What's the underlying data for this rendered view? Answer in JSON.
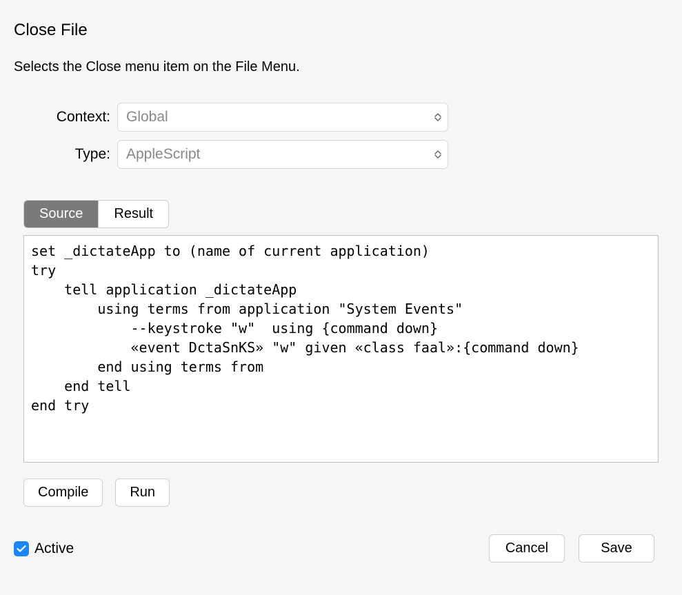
{
  "header": {
    "title": "Close File",
    "description": "Selects the Close menu item on the File Menu."
  },
  "form": {
    "context_label": "Context:",
    "context_value": "Global",
    "type_label": "Type:",
    "type_value": "AppleScript"
  },
  "tabs": {
    "source": "Source",
    "result": "Result",
    "active": "source"
  },
  "code": "set _dictateApp to (name of current application)\ntry\n    tell application _dictateApp\n        using terms from application \"System Events\"\n            --keystroke \"w\"  using {command down}\n            «event DctaSnKS» \"w\" given «class faal»:{command down}\n        end using terms from\n    end tell\nend try\n",
  "buttons": {
    "compile": "Compile",
    "run": "Run",
    "cancel": "Cancel",
    "save": "Save"
  },
  "footer": {
    "active_label": "Active",
    "active_checked": true
  }
}
